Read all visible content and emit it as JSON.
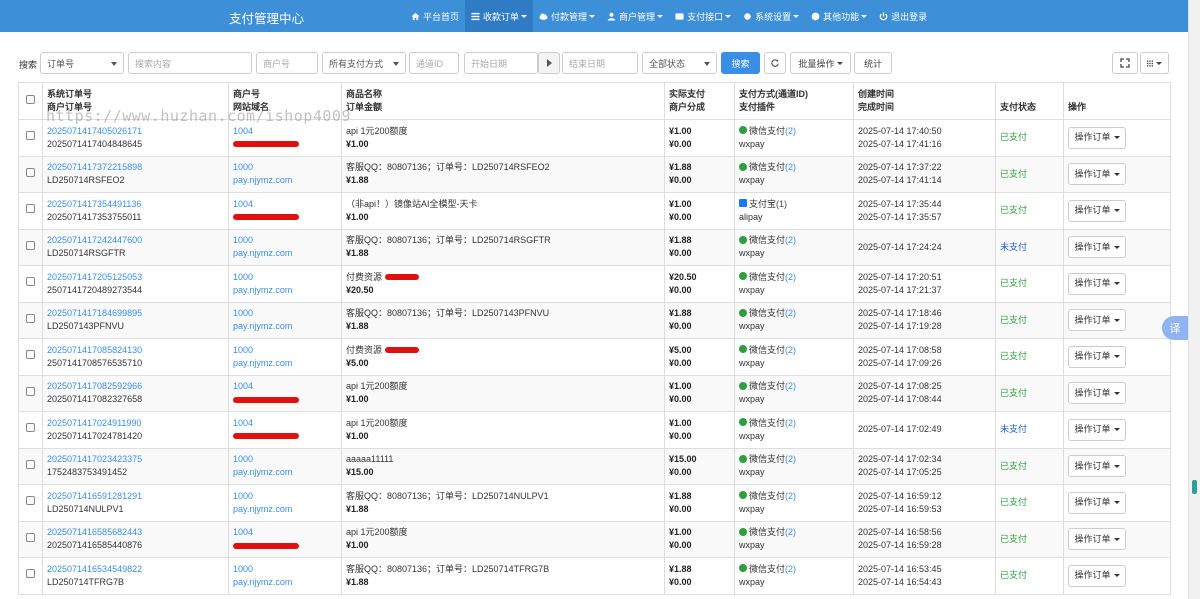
{
  "navbar": {
    "brand": "支付管理中心",
    "items": [
      {
        "label": "平台首页",
        "icon": "home-icon",
        "active": false,
        "caret": false
      },
      {
        "label": "收款订单",
        "icon": "list-icon",
        "active": true,
        "caret": true
      },
      {
        "label": "付款管理",
        "icon": "cloud-icon",
        "active": false,
        "caret": true
      },
      {
        "label": "商户管理",
        "icon": "user-icon",
        "active": false,
        "caret": true
      },
      {
        "label": "支付接口",
        "icon": "card-icon",
        "active": false,
        "caret": true
      },
      {
        "label": "系统设置",
        "icon": "gear-icon",
        "active": false,
        "caret": true
      },
      {
        "label": "其他功能",
        "icon": "globe-icon",
        "active": false,
        "caret": true
      },
      {
        "label": "退出登录",
        "icon": "power-icon",
        "active": false,
        "caret": false
      }
    ]
  },
  "toolbar": {
    "search_label": "搜索",
    "field_select": "订单号",
    "search_placeholder": "搜索内容",
    "merchant_placeholder": "商户号",
    "paytype_select": "所有支付方式",
    "channel_placeholder": "通道ID",
    "start_placeholder": "开始日期",
    "end_placeholder": "结束日期",
    "status_select": "全部状态",
    "search_button": "搜索",
    "batch_button": "批量操作",
    "stats_button": "统计"
  },
  "watermark": "https://www.huzhan.com/ishop4009",
  "table": {
    "headers": {
      "order": [
        "系统订单号",
        "商户订单号"
      ],
      "merchant": [
        "商户号",
        "网站域名"
      ],
      "product": [
        "商品名称",
        "订单金额"
      ],
      "actual": [
        "实际支付",
        "商户分成"
      ],
      "paymethod": [
        "支付方式(通道ID)",
        "支付插件"
      ],
      "time": [
        "创建时间",
        "完成时间"
      ],
      "status": "支付状态",
      "op": "操作"
    },
    "rows": [
      {
        "sys": "2025071417405026171",
        "mch_order": "2025071417404848645",
        "mch": "1004",
        "domain": "",
        "redact": "long",
        "name": "api 1元200额度",
        "amount": "¥1.00",
        "actual": "¥1.00",
        "share": "¥0.00",
        "pay": "微信支付",
        "channel": "(2)",
        "plugin": "wxpay",
        "ptype": "wx",
        "created": "2025-07-14 17:40:50",
        "finished": "2025-07-14 17:41:16",
        "status": "已支付",
        "paid": true
      },
      {
        "sys": "2025071417372215898",
        "mch_order": "LD250714RSFEO2",
        "mch": "1000",
        "domain": "pay.njymz.com",
        "redact": "",
        "name": "客服QQ：80807136；订单号：LD250714RSFEO2",
        "amount": "¥1.88",
        "actual": "¥1.88",
        "share": "¥0.00",
        "pay": "微信支付",
        "channel": "(2)",
        "plugin": "wxpay",
        "ptype": "wx",
        "created": "2025-07-14 17:37:22",
        "finished": "2025-07-14 17:41:14",
        "status": "已支付",
        "paid": true
      },
      {
        "sys": "2025071417354491136",
        "mch_order": "2025071417353755011",
        "mch": "1004",
        "domain": "",
        "redact": "long",
        "name": "（非api！）镜像站AI全模型-天卡",
        "amount": "¥1.00",
        "actual": "¥1.00",
        "share": "¥0.00",
        "pay": "支付宝",
        "channel": "(1)",
        "plugin": "alipay",
        "ptype": "ali",
        "created": "2025-07-14 17:35:44",
        "finished": "2025-07-14 17:35:57",
        "status": "已支付",
        "paid": true
      },
      {
        "sys": "2025071417242447600",
        "mch_order": "LD250714RSGFTR",
        "mch": "1000",
        "domain": "pay.njymz.com",
        "redact": "",
        "name": "客服QQ：80807136；订单号：LD250714RSGFTR",
        "amount": "¥1.88",
        "actual": "¥1.88",
        "share": "¥0.00",
        "pay": "微信支付",
        "channel": "(2)",
        "plugin": "wxpay",
        "ptype": "wx",
        "created": "2025-07-14 17:24:24",
        "finished": "",
        "status": "未支付",
        "paid": false
      },
      {
        "sys": "2025071417205125053",
        "mch_order": "2507141720489273544",
        "mch": "1000",
        "domain": "pay.njymz.com",
        "redact": "",
        "name": "付费资源",
        "name_redact": true,
        "amount": "¥20.50",
        "actual": "¥20.50",
        "share": "¥0.00",
        "pay": "微信支付",
        "channel": "(2)",
        "plugin": "wxpay",
        "ptype": "wx",
        "created": "2025-07-14 17:20:51",
        "finished": "2025-07-14 17:21:37",
        "status": "已支付",
        "paid": true
      },
      {
        "sys": "2025071417184699895",
        "mch_order": "LD2507143PFNVU",
        "mch": "1000",
        "domain": "pay.njymz.com",
        "redact": "",
        "name": "客服QQ：80807136；订单号：LD2507143PFNVU",
        "amount": "¥1.88",
        "actual": "¥1.88",
        "share": "¥0.00",
        "pay": "微信支付",
        "channel": "(2)",
        "plugin": "wxpay",
        "ptype": "wx",
        "created": "2025-07-14 17:18:46",
        "finished": "2025-07-14 17:19:28",
        "status": "已支付",
        "paid": true
      },
      {
        "sys": "2025071417085824130",
        "mch_order": "2507141708576535710",
        "mch": "1000",
        "domain": "pay.njymz.com",
        "redact": "",
        "name": "付费资源",
        "name_redact": true,
        "amount": "¥5.00",
        "actual": "¥5.00",
        "share": "¥0.00",
        "pay": "微信支付",
        "channel": "(2)",
        "plugin": "wxpay",
        "ptype": "wx",
        "created": "2025-07-14 17:08:58",
        "finished": "2025-07-14 17:09:26",
        "status": "已支付",
        "paid": true
      },
      {
        "sys": "2025071417082592966",
        "mch_order": "2025071417082327658",
        "mch": "1004",
        "domain": "",
        "redact": "long",
        "name": "api 1元200额度",
        "amount": "¥1.00",
        "actual": "¥1.00",
        "share": "¥0.00",
        "pay": "微信支付",
        "channel": "(2)",
        "plugin": "wxpay",
        "ptype": "wx",
        "created": "2025-07-14 17:08:25",
        "finished": "2025-07-14 17:08:44",
        "status": "已支付",
        "paid": true
      },
      {
        "sys": "2025071417024911990",
        "mch_order": "2025071417024781420",
        "mch": "1004",
        "domain": "",
        "redact": "long",
        "name": "api 1元200额度",
        "amount": "¥1.00",
        "actual": "¥1.00",
        "share": "¥0.00",
        "pay": "微信支付",
        "channel": "(2)",
        "plugin": "wxpay",
        "ptype": "wx",
        "created": "2025-07-14 17:02:49",
        "finished": "",
        "status": "未支付",
        "paid": false
      },
      {
        "sys": "2025071417023423375",
        "mch_order": "1752483753491452",
        "mch": "1000",
        "domain": "pay.njymz.com",
        "redact": "",
        "name": "aaaaa11111",
        "amount": "¥15.00",
        "actual": "¥15.00",
        "share": "¥0.00",
        "pay": "微信支付",
        "channel": "(2)",
        "plugin": "wxpay",
        "ptype": "wx",
        "created": "2025-07-14 17:02:34",
        "finished": "2025-07-14 17:05:25",
        "status": "已支付",
        "paid": true
      },
      {
        "sys": "2025071416591281291",
        "mch_order": "LD250714NULPV1",
        "mch": "1000",
        "domain": "pay.njymz.com",
        "redact": "",
        "name": "客服QQ：80807136；订单号：LD250714NULPV1",
        "amount": "¥1.88",
        "actual": "¥1.88",
        "share": "¥0.00",
        "pay": "微信支付",
        "channel": "(2)",
        "plugin": "wxpay",
        "ptype": "wx",
        "created": "2025-07-14 16:59:12",
        "finished": "2025-07-14 16:59:53",
        "status": "已支付",
        "paid": true
      },
      {
        "sys": "2025071416585682443",
        "mch_order": "2025071416585440876",
        "mch": "1004",
        "domain": "",
        "redact": "long",
        "name": "api 1元200额度",
        "amount": "¥1.00",
        "actual": "¥1.00",
        "share": "¥0.00",
        "pay": "微信支付",
        "channel": "(2)",
        "plugin": "wxpay",
        "ptype": "wx",
        "created": "2025-07-14 16:58:56",
        "finished": "2025-07-14 16:59:28",
        "status": "已支付",
        "paid": true
      },
      {
        "sys": "2025071416534549822",
        "mch_order": "LD250714TFRG7B",
        "mch": "1000",
        "domain": "pay.njymz.com",
        "redact": "",
        "name": "客服QQ：80807136；订单号：LD250714TFRG7B",
        "amount": "¥1.88",
        "actual": "¥1.88",
        "share": "¥0.00",
        "pay": "微信支付",
        "channel": "(2)",
        "plugin": "wxpay",
        "ptype": "wx",
        "created": "2025-07-14 16:53:45",
        "finished": "2025-07-14 16:54:43",
        "status": "已支付",
        "paid": true
      }
    ],
    "op_label": "操作订单"
  },
  "colors": {
    "navbar": "#3d8fd8",
    "link": "#3a8ee6",
    "paid": "#2e9e3f",
    "unpaid": "#1e5fc4"
  }
}
